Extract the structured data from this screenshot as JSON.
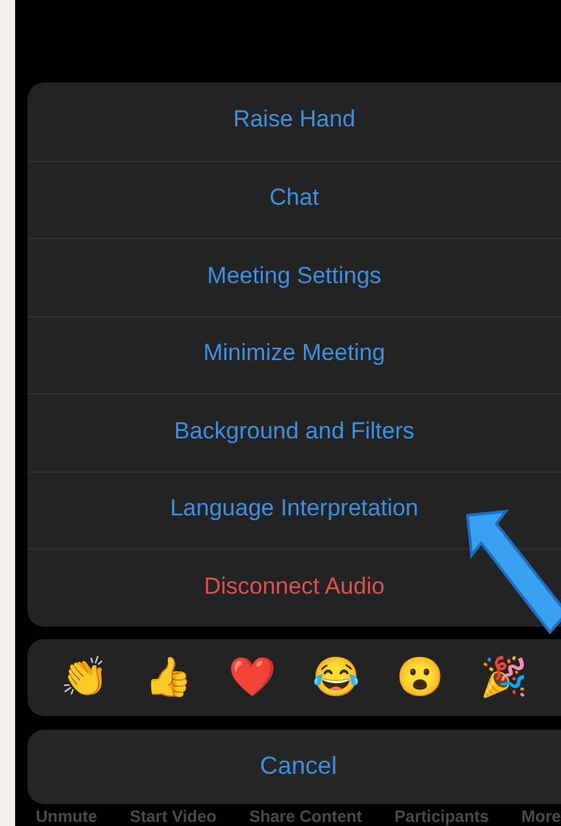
{
  "menu": [
    {
      "label": "Raise Hand",
      "kind": "action"
    },
    {
      "label": "Chat",
      "kind": "action"
    },
    {
      "label": "Meeting Settings",
      "kind": "action"
    },
    {
      "label": "Minimize Meeting",
      "kind": "action"
    },
    {
      "label": "Background and Filters",
      "kind": "action"
    },
    {
      "label": "Language Interpretation",
      "kind": "action"
    },
    {
      "label": "Disconnect Audio",
      "kind": "destructive"
    }
  ],
  "reactions": [
    "👏",
    "👍",
    "❤️",
    "😂",
    "😮",
    "🎉"
  ],
  "cancel": "Cancel",
  "toolbar": [
    "Unmute",
    "Start Video",
    "Share Content",
    "Participants",
    "More"
  ]
}
